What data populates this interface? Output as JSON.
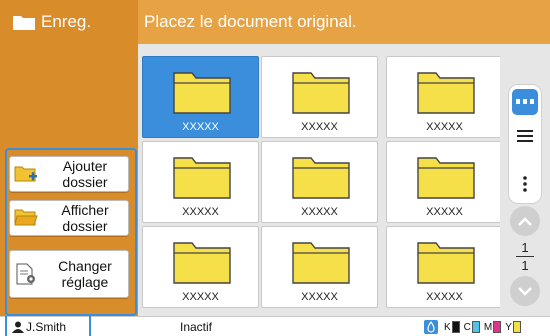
{
  "left_panel": {
    "title": "Enreg."
  },
  "header": {
    "message": "Placez le document original."
  },
  "grid": {
    "folders": [
      {
        "label": "XXXXX",
        "selected": true
      },
      {
        "label": "XXXXX",
        "selected": false
      },
      {
        "label": "XXXXX",
        "selected": false
      },
      {
        "label": "XXXXX",
        "selected": false
      },
      {
        "label": "XXXXX",
        "selected": false
      },
      {
        "label": "XXXXX",
        "selected": false
      },
      {
        "label": "XXXXX",
        "selected": false
      },
      {
        "label": "XXXXX",
        "selected": false
      },
      {
        "label": "XXXXX",
        "selected": false
      }
    ]
  },
  "view_controls": {
    "icons": [
      "grid-view-icon",
      "list-view-icon",
      "more-options-icon"
    ]
  },
  "pagination": {
    "current": "1",
    "total": "1"
  },
  "actions": {
    "add_folder": "Ajouter dossier",
    "show_folder": "Afficher dossier",
    "change_settings": "Changer réglage"
  },
  "status_bar": {
    "user": "J.Smith",
    "state": "Inactif",
    "ink": [
      {
        "label": "K",
        "color": "#111111"
      },
      {
        "label": "C",
        "color": "#4fc3e8"
      },
      {
        "label": "M",
        "color": "#e0338f"
      },
      {
        "label": "Y",
        "color": "#f1e04a"
      }
    ]
  },
  "colors": {
    "accent": "#3a8edc",
    "header_orange": "#e7a343",
    "panel_orange": "#d98c2a",
    "folder_yellow": "#f5e04a"
  }
}
